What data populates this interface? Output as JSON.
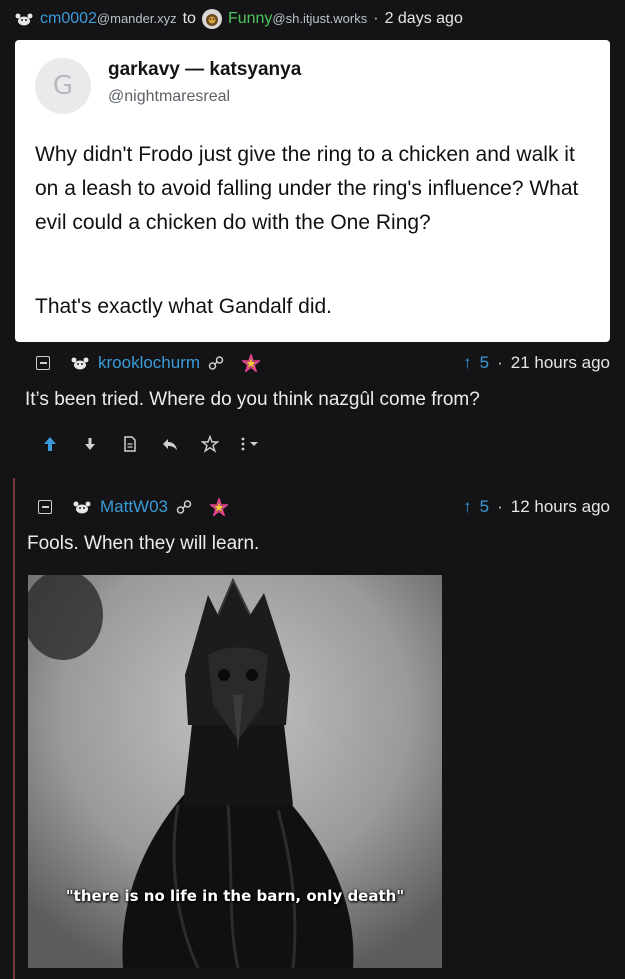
{
  "post": {
    "author_name": "cm0002",
    "author_instance": "@mander.xyz",
    "to_label": "to",
    "community_name": "Funny",
    "community_instance": "@sh.itjust.works",
    "separator": "·",
    "age": "2 days ago"
  },
  "tweet": {
    "avatar_letter": "G",
    "display_name": "garkavy — katsyanya",
    "handle": "@nightmaresreal",
    "text": "Why didn't Frodo just give the ring to a chicken and walk it on a leash to avoid falling under the ring's influence? What evil could a chicken do with the One Ring?",
    "text2": "That's exactly what Gandalf did."
  },
  "comments": [
    {
      "user": "krooklochurm",
      "score_arrow": "↑",
      "score": "5",
      "separator": "·",
      "age": "21 hours ago",
      "text": "It’s been tried. Where do you think nazgûl come from?"
    },
    {
      "user": "MattW03",
      "score_arrow": "↑",
      "score": "5",
      "separator": "·",
      "age": "12 hours ago",
      "text": "Fools. When they will learn.",
      "image_caption": "\"there is no life in the barn, only death\""
    }
  ],
  "actions": {
    "icons": [
      "upvote-icon",
      "downvote-icon",
      "view-source-icon",
      "reply-icon",
      "save-star-icon",
      "more-options-icon"
    ]
  },
  "colors": {
    "background": "#141416",
    "link": "#3b9bd8",
    "thread_line": "#7a3a3a",
    "card": "#ffffff"
  }
}
